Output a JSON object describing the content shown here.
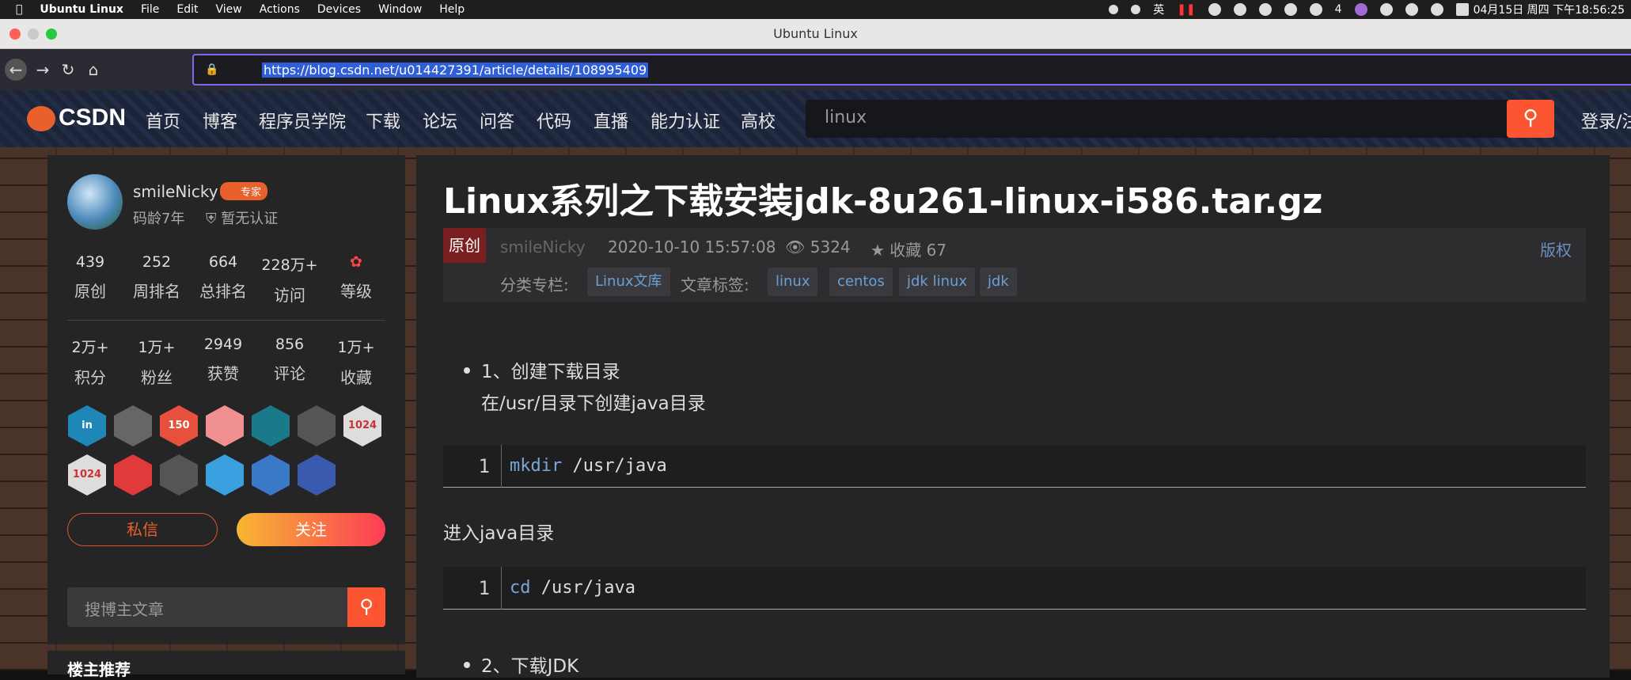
{
  "menubar": {
    "app": "Ubuntu Linux",
    "items": [
      "File",
      "Edit",
      "View",
      "Actions",
      "Devices",
      "Window",
      "Help"
    ],
    "ime": "英",
    "wechat_count": "4",
    "clock": "04月15日 周四 下午18:56:25"
  },
  "window": {
    "title": "Ubuntu Linux"
  },
  "browser": {
    "url": "https://blog.csdn.net/u014427391/article/details/108995409"
  },
  "csdn": {
    "logo": "CSDN",
    "nav": [
      "首页",
      "博客",
      "程序员学院",
      "下载",
      "论坛",
      "问答",
      "代码",
      "直播",
      "能力认证",
      "高校"
    ],
    "search_value": "linux",
    "login": "登录/注"
  },
  "profile": {
    "name": "smileNicky",
    "badge": "专家",
    "age": "码龄7年",
    "cert": "暂无认证",
    "stats1": [
      {
        "v": "439",
        "l": "原创"
      },
      {
        "v": "252",
        "l": "周排名"
      },
      {
        "v": "664",
        "l": "总排名"
      },
      {
        "v": "228万+",
        "l": "访问"
      },
      {
        "v": "",
        "l": "等级"
      }
    ],
    "stats2": [
      {
        "v": "2万+",
        "l": "积分"
      },
      {
        "v": "1万+",
        "l": "粉丝"
      },
      {
        "v": "2949",
        "l": "获赞"
      },
      {
        "v": "856",
        "l": "评论"
      },
      {
        "v": "1万+",
        "l": "收藏"
      }
    ],
    "badges_row1": [
      "in",
      "",
      "150",
      "",
      "",
      "",
      "1024"
    ],
    "badges_row2": [
      "1024",
      "",
      "",
      "",
      "",
      "",
      ""
    ],
    "message_btn": "私信",
    "follow_btn": "关注",
    "search_placeholder": "搜博主文章",
    "recommend_title": "楼主推荐"
  },
  "article": {
    "title": "Linux系列之下载安装jdk-8u261-linux-i586.tar.gz",
    "original": "原创",
    "author": "smileNicky",
    "date": "2020-10-10 15:57:08",
    "views": "5324",
    "favorites": "收藏 67",
    "copyright": "版权",
    "category_label": "分类专栏:",
    "category": "Linux文库",
    "tags_label": "文章标签:",
    "tags": [
      "linux",
      "centos",
      "jdk linux",
      "jdk"
    ],
    "step1": "1、创建下载目录",
    "step1_sub": "在/usr/目录下创建java目录",
    "code1_ln": "1",
    "code1_kw": "mkdir",
    "code1_arg": " /usr/java",
    "enter_java": "进入java目录",
    "code2_ln": "1",
    "code2_kw": "cd",
    "code2_arg": " /usr/java",
    "step2": "2、下载JDK"
  }
}
